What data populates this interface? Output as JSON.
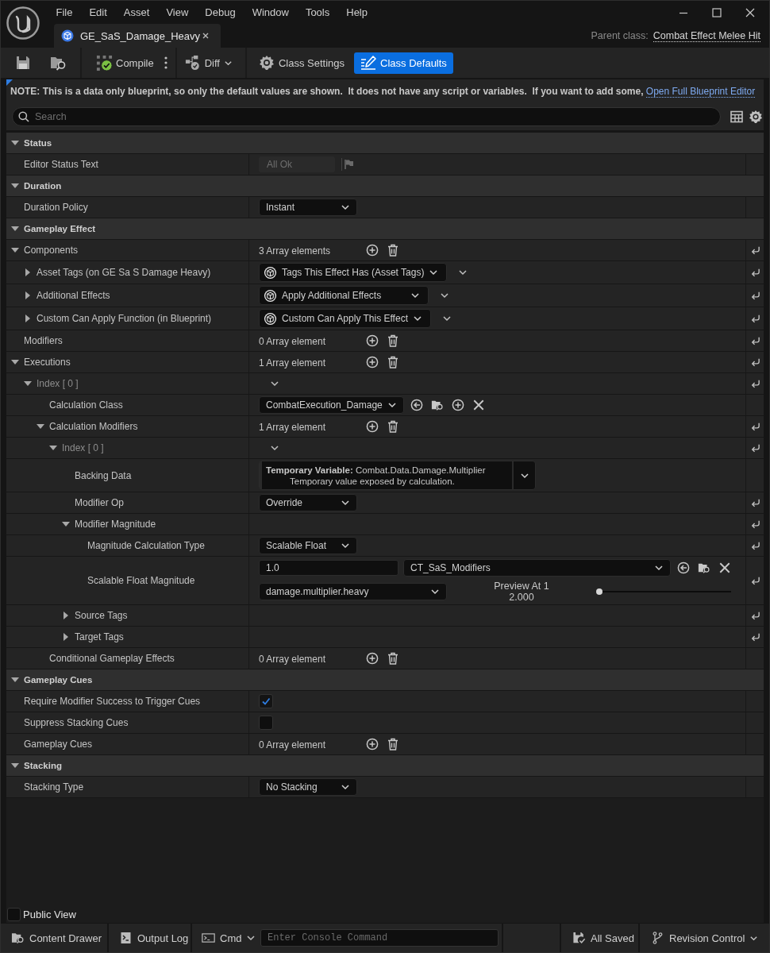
{
  "window": {
    "menu": [
      "File",
      "Edit",
      "Asset",
      "View",
      "Debug",
      "Window",
      "Tools",
      "Help"
    ]
  },
  "tabs": [
    {
      "label": "GE_SaS_Damage_Heavy",
      "selected": true
    }
  ],
  "parent_class": {
    "label": "Parent class:",
    "value": "Combat Effect Melee Hit"
  },
  "toolbar": {
    "compile": "Compile",
    "diff": "Diff",
    "modes": [
      {
        "kind": "settings",
        "label": "Class Settings",
        "selected": false
      },
      {
        "kind": "defaults",
        "label": "Class Defaults",
        "selected": true
      }
    ]
  },
  "note": {
    "text": "NOTE: This is a data only blueprint, so only the default values are shown.  It does not have any script or variables.  If you want to add some, ",
    "link": "Open Full Blueprint Editor"
  },
  "search": {
    "placeholder": "Search"
  },
  "categories": [
    {
      "title": "Status",
      "expanded": true,
      "properties": [
        {
          "name": "Editor Status Text",
          "kind": "readonly",
          "value": "All Ok",
          "reset": false
        }
      ]
    },
    {
      "title": "Duration",
      "expanded": true,
      "properties": [
        {
          "name": "Duration Policy",
          "kind": "combo",
          "value": "Instant",
          "reset": false
        }
      ]
    },
    {
      "title": "Gameplay Effect",
      "expanded": true,
      "properties": [
        {
          "name": "Components",
          "kind": "array",
          "value": "3 Array elements",
          "reset": true,
          "expanded": true,
          "children": [
            {
              "name": "Asset Tags (on GE Sa S Damage Heavy)",
              "kind": "instanced",
              "value": "Tags This Effect Has (Asset Tags)",
              "reset": true,
              "expanded": false
            },
            {
              "name": "Additional Effects",
              "kind": "instanced",
              "value": "Apply Additional Effects",
              "reset": true,
              "expanded": false
            },
            {
              "name": "Custom Can Apply Function (in Blueprint)",
              "kind": "instanced",
              "value": "Custom Can Apply This Effect",
              "reset": true,
              "expanded": false
            }
          ]
        },
        {
          "name": "Modifiers",
          "kind": "array",
          "value": "0 Array element",
          "reset": true
        },
        {
          "name": "Executions",
          "kind": "array",
          "value": "1 Array element",
          "reset": true,
          "expanded": true,
          "children": [
            {
              "name": "Index [ 0 ]",
              "kind": "struct",
              "element": true,
              "reset": true,
              "expanded": true,
              "children": [
                {
                  "name": "Calculation Class",
                  "kind": "class",
                  "value": "CombatExecution_Damage",
                  "reset": false
                },
                {
                  "name": "Calculation Modifiers",
                  "kind": "array",
                  "value": "1 Array element",
                  "reset": true,
                  "expanded": true,
                  "children": [
                    {
                      "name": "Index [ 0 ]",
                      "kind": "struct",
                      "element": true,
                      "reset": true,
                      "expanded": true,
                      "children": [
                        {
                          "name": "Backing Data",
                          "kind": "backing",
                          "value": "**Temporary Variable:** Combat.Data.Damage.Multiplier",
                          "description": "Temporary value exposed by calculation.",
                          "reset": false
                        },
                        {
                          "name": "Modifier Op",
                          "kind": "combo",
                          "value": "Override",
                          "reset": true
                        },
                        {
                          "name": "Modifier Magnitude",
                          "kind": "none",
                          "reset": true,
                          "expanded": true,
                          "children": [
                            {
                              "name": "Magnitude Calculation Type",
                              "kind": "combo",
                              "value": "Scalable Float",
                              "reset": true
                            },
                            {
                              "name": "Scalable Float Magnitude",
                              "kind": "scalable_float",
                              "value": "1.0",
                              "table": "CT_SaS_Modifiers",
                              "row": "damage.multiplier.heavy",
                              "preview_label": "Preview At 1",
                              "preview_value": "2.000",
                              "level": 0,
                              "reset": true
                            }
                          ]
                        },
                        {
                          "name": "Source Tags",
                          "kind": "none",
                          "reset": true,
                          "expanded": false
                        },
                        {
                          "name": "Target Tags",
                          "kind": "none",
                          "reset": true,
                          "expanded": false
                        }
                      ]
                    }
                  ]
                },
                {
                  "name": "Conditional Gameplay Effects",
                  "kind": "array",
                  "value": "0 Array element",
                  "reset": false
                }
              ]
            }
          ]
        }
      ]
    },
    {
      "title": "Gameplay Cues",
      "expanded": true,
      "properties": [
        {
          "name": "Require Modifier Success to Trigger Cues",
          "kind": "checkbox",
          "checked": true,
          "reset": false
        },
        {
          "name": "Suppress Stacking Cues",
          "kind": "checkbox",
          "checked": false,
          "reset": false
        },
        {
          "name": "Gameplay Cues",
          "kind": "array",
          "value": "0 Array element",
          "reset": false
        }
      ]
    },
    {
      "title": "Stacking",
      "expanded": true,
      "properties": [
        {
          "name": "Stacking Type",
          "kind": "combo",
          "value": "No Stacking",
          "reset": false
        }
      ]
    }
  ],
  "public_view": {
    "label": "Public View",
    "checked": false
  },
  "status_bar": {
    "content_drawer": "Content Drawer",
    "output_log": "Output Log",
    "cmd": "Cmd",
    "console": {
      "placeholder": "Enter Console Command"
    },
    "save_state": "All Saved",
    "revision_control": "Revision Control"
  }
}
